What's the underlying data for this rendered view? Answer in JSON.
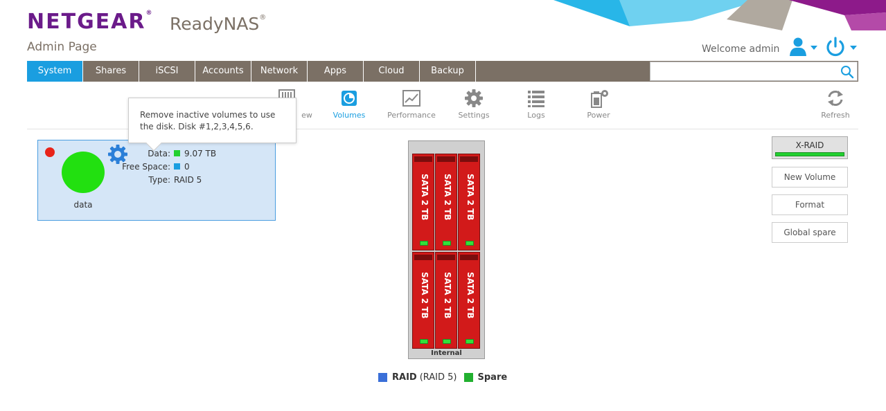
{
  "header": {
    "brand": "NETGEAR",
    "brand_mark": "®",
    "product": "ReadyNAS",
    "product_mark": "®",
    "subtitle": "Admin Page",
    "welcome": "Welcome admin",
    "icons": {
      "user": "user-icon",
      "power": "power-icon"
    }
  },
  "nav": {
    "tabs": [
      "System",
      "Shares",
      "iSCSI",
      "Accounts",
      "Network",
      "Apps",
      "Cloud",
      "Backup"
    ],
    "active": "System",
    "search_value": ""
  },
  "subnav": {
    "items": [
      {
        "label": "Overview",
        "visible_label": "ew",
        "icon": "overview-icon"
      },
      {
        "label": "Volumes",
        "icon": "volumes-icon",
        "active": true
      },
      {
        "label": "Performance",
        "icon": "performance-icon"
      },
      {
        "label": "Settings",
        "icon": "gear-icon"
      },
      {
        "label": "Logs",
        "icon": "logs-icon"
      },
      {
        "label": "Power",
        "icon": "power-settings-icon"
      },
      {
        "label": "Refresh",
        "icon": "refresh-icon"
      }
    ]
  },
  "tooltip": {
    "line1": "Remove inactive volumes to use",
    "line2": "the disk. Disk #1,2,3,4,5,6."
  },
  "volume": {
    "name": "data",
    "status_color": "#e8241a",
    "data_label": "Data:",
    "data_value": "9.07 TB",
    "data_color": "#22d030",
    "free_label": "Free Space:",
    "free_value": "0",
    "free_color": "#1a9ee0",
    "type_label": "Type:",
    "type_value": "RAID 5"
  },
  "enclosure": {
    "label": "Internal",
    "disks": [
      "SATA 2 TB",
      "SATA 2 TB",
      "SATA 2 TB",
      "SATA 2 TB",
      "SATA 2 TB",
      "SATA 2 TB"
    ]
  },
  "legend": {
    "raid_label": "RAID",
    "raid_detail": "(RAID 5)",
    "raid_color": "#3a6fd8",
    "spare_label": "Spare",
    "spare_color": "#22b030"
  },
  "actions": {
    "xraid": "X-RAID",
    "new_volume": "New Volume",
    "format": "Format",
    "global_spare": "Global spare"
  },
  "colors": {
    "brand": "#6b1b8a",
    "accent": "#1a9ee0",
    "nav_bg": "#7b7065"
  }
}
